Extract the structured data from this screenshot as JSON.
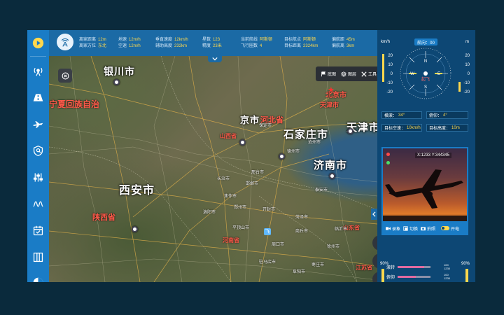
{
  "topbar": {
    "stats": [
      {
        "label": "离家距离",
        "value": "12m"
      },
      {
        "label": "离家方位",
        "value": "东北"
      },
      {
        "label": "地速",
        "value": "12m/h"
      },
      {
        "label": "空速",
        "value": "12m/h"
      },
      {
        "label": "垂直速度",
        "value": "12km/h"
      },
      {
        "label": "辅助高度",
        "value": "232km"
      },
      {
        "label": "星数",
        "value": "123"
      },
      {
        "label": "精度",
        "value": "23米"
      },
      {
        "label": "当前航线",
        "value": "阿斯顿"
      },
      {
        "label": "飞行圈数",
        "value": "4"
      },
      {
        "label": "目标航点",
        "value": "阿斯顿"
      },
      {
        "label": "目标距离",
        "value": "2324km"
      },
      {
        "label": "偏航距",
        "value": "45m"
      },
      {
        "label": "偏航离",
        "value": "3km"
      }
    ]
  },
  "map": {
    "tools": {
      "base": "底图",
      "layer": "图层",
      "tool": "工具"
    },
    "cities": [
      {
        "name": "银川市"
      },
      {
        "name": "北京市"
      },
      {
        "name": "天津市"
      },
      {
        "name": "天津市"
      },
      {
        "name": "石家庄市"
      },
      {
        "name": "济南市"
      },
      {
        "name": "西安市"
      },
      {
        "name": "京市"
      }
    ],
    "provinces": [
      {
        "name": "宁夏回族自治"
      },
      {
        "name": "河北省"
      },
      {
        "name": "山西省"
      },
      {
        "name": "陕西省"
      },
      {
        "name": "河南省"
      },
      {
        "name": "山东省"
      },
      {
        "name": "江苏省"
      }
    ],
    "towns": [
      {
        "name": "郑州市"
      },
      {
        "name": "邢台市"
      },
      {
        "name": "邯郸市"
      },
      {
        "name": "长治市"
      },
      {
        "name": "焦作市"
      },
      {
        "name": "洛阳市"
      },
      {
        "name": "开封市"
      },
      {
        "name": "商丘市"
      },
      {
        "name": "徐州市"
      },
      {
        "name": "周口市"
      },
      {
        "name": "驻马店市"
      },
      {
        "name": "临沂市"
      },
      {
        "name": "泰安市"
      },
      {
        "name": "德州市"
      },
      {
        "name": "沧州市"
      },
      {
        "name": "保定市"
      },
      {
        "name": "阜阳市"
      },
      {
        "name": "平顶山市"
      },
      {
        "name": "枣庄市"
      },
      {
        "name": "菏泽市"
      }
    ],
    "uav_label": "飞"
  },
  "instrument": {
    "unit_left": "km/h",
    "unit_right": "m",
    "heading": "航向：00",
    "speed_ticks": [
      "20",
      "10",
      "0",
      "-10",
      "-20"
    ],
    "alt_ticks": [
      "20",
      "10",
      "0",
      "-10",
      "-20"
    ],
    "compass_labels": {
      "n": "N",
      "e": "E",
      "s": "S",
      "w": "W",
      "status": "起飞"
    },
    "roll": {
      "label": "横滚：",
      "value": "34°"
    },
    "pitch": {
      "label": "俯仰：",
      "value": "4°"
    },
    "target_speed": {
      "label": "目标空速：",
      "value": "10km/h"
    },
    "target_alt": {
      "label": "目标高度：",
      "value": "10m"
    }
  },
  "camera": {
    "coords": "X:1233   Y:344345",
    "record": "录象",
    "switch": "切换",
    "photo": "拍照",
    "power": "开电"
  },
  "gauges": {
    "left_pct": "90%",
    "right_pct": "90%",
    "roll_label": "滚转",
    "pitch_label": "俯仰",
    "roll_level": 0.8,
    "pitch_level": 0.55,
    "roll_nums": [
      "100",
      "1235"
    ],
    "pitch_nums": [
      "100",
      "1235"
    ]
  },
  "colors": {
    "accent": "#1a7cc6",
    "topbar": "#1b6aa5",
    "panel": "#0d4774",
    "value": "#ffd84d",
    "province": "#ff5a4a"
  }
}
